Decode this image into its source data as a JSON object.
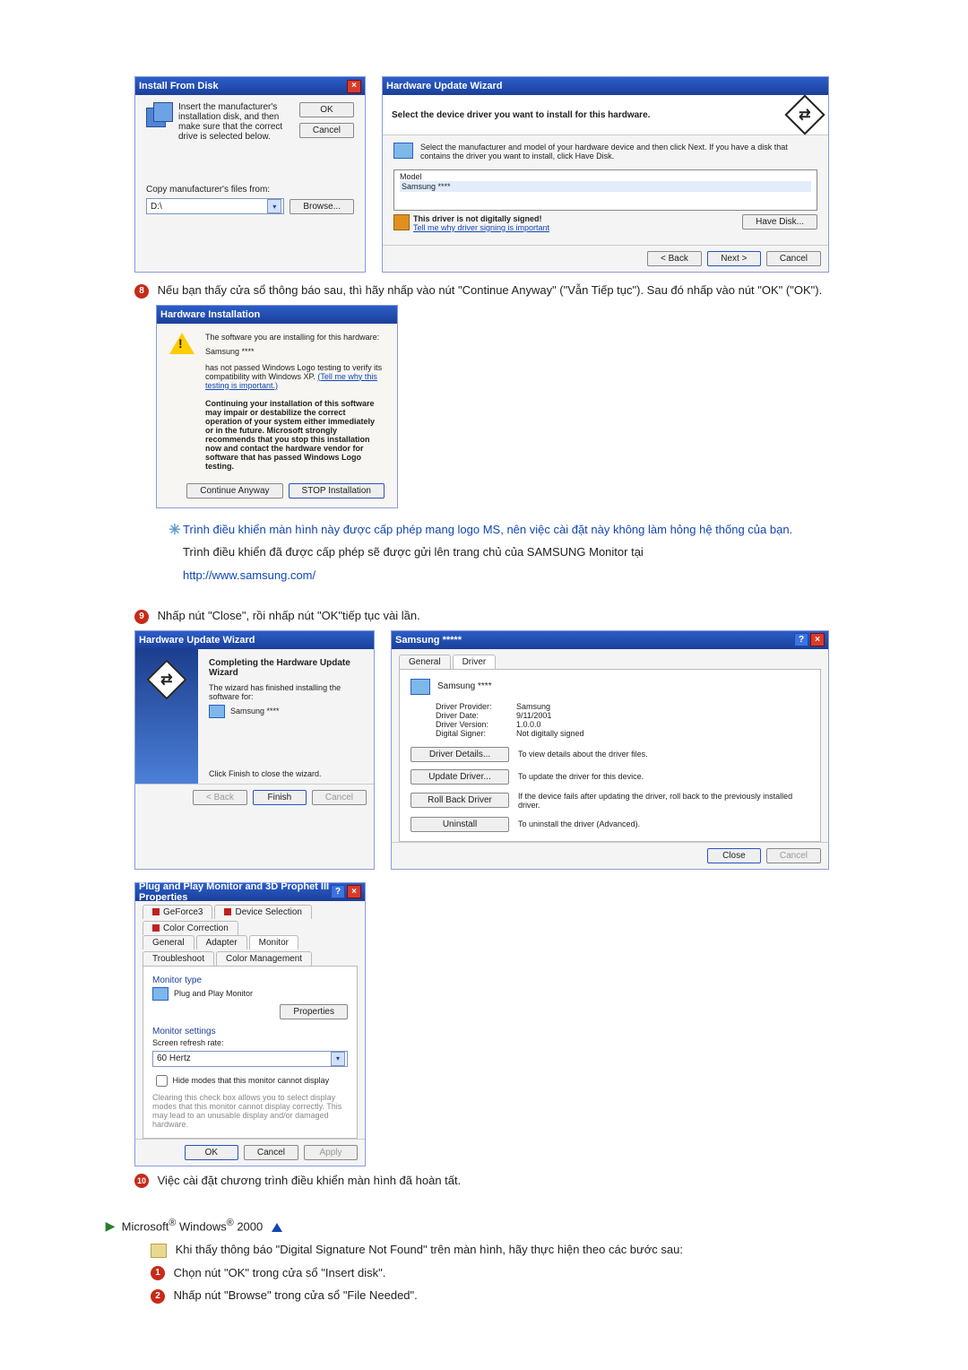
{
  "install_from_disk": {
    "title": "Install From Disk",
    "instruction": "Insert the manufacturer's installation disk, and then make sure that the correct drive is selected below.",
    "ok": "OK",
    "cancel": "Cancel",
    "copy_label": "Copy manufacturer's files from:",
    "path": "D:\\",
    "browse": "Browse..."
  },
  "hw_update_select": {
    "title": "Hardware Update Wizard",
    "heading": "Select the device driver you want to install for this hardware.",
    "desc": "Select the manufacturer and model of your hardware device and then click Next. If you have a disk that contains the driver you want to install, click Have Disk.",
    "model_label": "Model",
    "model_value": "Samsung ****",
    "unsigned": "This driver is not digitally signed!",
    "signing_link": "Tell me why driver signing is important",
    "have_disk": "Have Disk...",
    "back": "< Back",
    "next": "Next >",
    "cancel": "Cancel"
  },
  "step8": {
    "text": "Nếu bạn thấy cửa sổ thông báo sau, thì hãy nhấp vào nút \"Continue Anyway\" (\"Vẫn Tiếp tục\"). Sau đó nhấp vào nút \"OK\" (\"OK\")."
  },
  "hw_install": {
    "title": "Hardware Installation",
    "line1": "The software you are installing for this hardware:",
    "device": "Samsung ****",
    "line2": "has not passed Windows Logo testing to verify its compatibility with Windows XP.",
    "logo_link": "(Tell me why this testing is important.)",
    "bold_block": "Continuing your installation of this software may impair or destabilize the correct operation of your system either immediately or in the future. Microsoft strongly recommends that you stop this installation now and contact the hardware vendor for software that has passed Windows Logo testing.",
    "continue": "Continue Anyway",
    "stop": "STOP Installation"
  },
  "note": {
    "line1": "Trình điều khiển màn hình này được cấp phép mang logo MS, nên việc cài đặt này không làm hỏng hệ thống của bạn.",
    "line2": "Trình điều khiển đã được cấp phép sẽ được gửi lên trang chủ của SAMSUNG Monitor tại",
    "url": "http://www.samsung.com/"
  },
  "step9": {
    "text": "Nhấp nút \"Close\", rồi nhấp nút \"OK\"tiếp tục vài lần."
  },
  "hw_complete": {
    "title": "Hardware Update Wizard",
    "heading": "Completing the Hardware Update Wizard",
    "subtext": "The wizard has finished installing the software for:",
    "device": "Samsung ****",
    "finish_hint": "Click Finish to close the wizard.",
    "back": "< Back",
    "finish": "Finish",
    "cancel": "Cancel"
  },
  "props_driver": {
    "title": "Samsung *****",
    "tab_general": "General",
    "tab_driver": "Driver",
    "device": "Samsung ****",
    "dp_label": "Driver Provider:",
    "dp_val": "Samsung",
    "dd_label": "Driver Date:",
    "dd_val": "9/11/2001",
    "dv_label": "Driver Version:",
    "dv_val": "1.0.0.0",
    "ds_label": "Digital Signer:",
    "ds_val": "Not digitally signed",
    "btn_details": "Driver Details...",
    "btn_details_desc": "To view details about the driver files.",
    "btn_update": "Update Driver...",
    "btn_update_desc": "To update the driver for this device.",
    "btn_rollback": "Roll Back Driver",
    "btn_rollback_desc": "If the device fails after updating the driver, roll back to the previously installed driver.",
    "btn_uninstall": "Uninstall",
    "btn_uninstall_desc": "To uninstall the driver (Advanced).",
    "close": "Close",
    "cancel": "Cancel"
  },
  "pnp": {
    "title": "Plug and Play Monitor and 3D Prophet III Properties",
    "tabs": [
      "GeForce3",
      "Device Selection",
      "Color Correction",
      "General",
      "Adapter",
      "Monitor",
      "Troubleshoot",
      "Color Management"
    ],
    "monitor_type_label": "Monitor type",
    "monitor_name": "Plug and Play Monitor",
    "properties": "Properties",
    "settings_label": "Monitor settings",
    "refresh_label": "Screen refresh rate:",
    "refresh_value": "60 Hertz",
    "hide_modes": "Hide modes that this monitor cannot display",
    "hide_desc": "Clearing this check box allows you to select display modes that this monitor cannot display correctly. This may lead to an unusable display and/or damaged hardware.",
    "ok": "OK",
    "cancel": "Cancel",
    "apply": "Apply"
  },
  "step10": {
    "text": "Việc cài đặt chương trình điều khiển màn hình đã hoàn tất."
  },
  "win2000": {
    "heading_pre": "Microsoft",
    "heading_mid": "Windows",
    "heading_suf": "2000",
    "intro": "Khi thấy thông báo \"Digital Signature Not Found\" trên màn hình, hãy thực hiện theo các bước sau:",
    "s1": "Chọn nút \"OK\" trong cửa sổ \"Insert disk\".",
    "s2": "Nhấp nút \"Browse\" trong cửa sổ \"File Needed\"."
  }
}
